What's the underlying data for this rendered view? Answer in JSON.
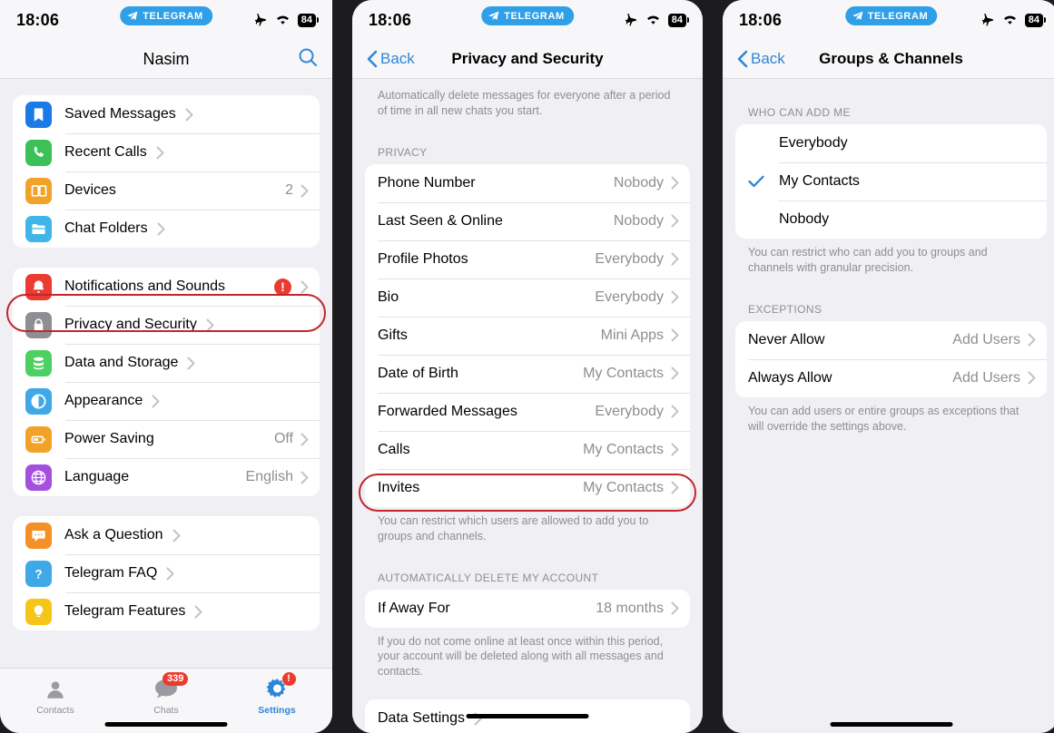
{
  "statusbar": {
    "time": "18:06",
    "carrier_pill": "TELEGRAM",
    "battery": "84",
    "icons": [
      "airplane-mode-icon",
      "wifi-icon",
      "battery-icon"
    ]
  },
  "colors": {
    "accent_blue": "#2f86d8",
    "highlight_red": "#c0272d",
    "badge_red": "#eb3b30",
    "page_bg": "#efeff4",
    "card_bg": "#ffffff",
    "secondary_text": "#8e8e93"
  },
  "panel1": {
    "title": "Nasim",
    "search_icon": "search-icon",
    "group1": [
      {
        "label": "Saved Messages",
        "value": "",
        "icon": "bookmark-icon",
        "color": "#1a7ae8"
      },
      {
        "label": "Recent Calls",
        "value": "",
        "icon": "phone-icon",
        "color": "#3cc157"
      },
      {
        "label": "Devices",
        "value": "2",
        "icon": "devices-icon",
        "color": "#f3a229"
      },
      {
        "label": "Chat Folders",
        "value": "",
        "icon": "folder-icon",
        "color": "#3fb5e8"
      }
    ],
    "group2": [
      {
        "label": "Notifications and Sounds",
        "value": "",
        "icon": "bell-icon",
        "color": "#ec3b31",
        "badge": "!"
      },
      {
        "label": "Privacy and Security",
        "value": "",
        "icon": "lock-icon",
        "color": "#8e8e93",
        "highlighted": true
      },
      {
        "label": "Data and Storage",
        "value": "",
        "icon": "database-icon",
        "color": "#4cd05f"
      },
      {
        "label": "Appearance",
        "value": "",
        "icon": "contrast-icon",
        "color": "#3fa9e8"
      },
      {
        "label": "Power Saving",
        "value": "Off",
        "icon": "battery-saver-icon",
        "color": "#f3a229"
      },
      {
        "label": "Language",
        "value": "English",
        "icon": "globe-icon",
        "color": "#a44fe0"
      }
    ],
    "group3": [
      {
        "label": "Ask a Question",
        "value": "",
        "icon": "chat-bubble-icon",
        "color": "#f59026"
      },
      {
        "label": "Telegram FAQ",
        "value": "",
        "icon": "question-mark-icon",
        "color": "#3fa9e8"
      },
      {
        "label": "Telegram Features",
        "value": "",
        "icon": "lightbulb-icon",
        "color": "#f5c518"
      }
    ],
    "tabbar": [
      {
        "label": "Contacts",
        "icon": "contacts-icon",
        "active": false,
        "badge": ""
      },
      {
        "label": "Chats",
        "icon": "chats-icon",
        "active": false,
        "badge": "339"
      },
      {
        "label": "Settings",
        "icon": "settings-gear-icon",
        "active": true,
        "badge": "!"
      }
    ]
  },
  "panel2": {
    "back_label": "Back",
    "title": "Privacy and Security",
    "top_footnote": "Automatically delete messages for everyone after a period of time in all new chats you start.",
    "section_privacy": "PRIVACY",
    "privacy_rows": [
      {
        "label": "Phone Number",
        "value": "Nobody"
      },
      {
        "label": "Last Seen & Online",
        "value": "Nobody"
      },
      {
        "label": "Profile Photos",
        "value": "Everybody"
      },
      {
        "label": "Bio",
        "value": "Everybody"
      },
      {
        "label": "Gifts",
        "value": "Mini Apps"
      },
      {
        "label": "Date of Birth",
        "value": "My Contacts"
      },
      {
        "label": "Forwarded Messages",
        "value": "Everybody"
      },
      {
        "label": "Calls",
        "value": "My Contacts"
      },
      {
        "label": "Invites",
        "value": "My Contacts",
        "highlighted": true
      }
    ],
    "privacy_footnote": "You can restrict which users are allowed to add you to groups and channels.",
    "section_delete": "AUTOMATICALLY DELETE MY ACCOUNT",
    "delete_row": {
      "label": "If Away For",
      "value": "18 months"
    },
    "delete_footnote": "If you do not come online at least once within this period, your account will be deleted along with all messages and contacts.",
    "last_row": {
      "label": "Data Settings",
      "value": ""
    }
  },
  "panel3": {
    "back_label": "Back",
    "title": "Groups & Channels",
    "section_who": "WHO CAN ADD ME",
    "who_options": [
      {
        "label": "Everybody",
        "selected": false
      },
      {
        "label": "My Contacts",
        "selected": true
      },
      {
        "label": "Nobody",
        "selected": false
      }
    ],
    "who_footnote": "You can restrict who can add you to groups and channels with granular precision.",
    "section_exceptions": "EXCEPTIONS",
    "exception_rows": [
      {
        "label": "Never Allow",
        "value": "Add Users"
      },
      {
        "label": "Always Allow",
        "value": "Add Users"
      }
    ],
    "exceptions_footnote": "You can add users or entire groups as exceptions that will override the settings above."
  }
}
